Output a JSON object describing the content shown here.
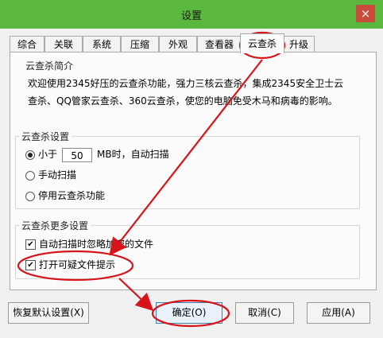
{
  "window": {
    "title": "设置",
    "close_label": "×"
  },
  "tabs": [
    {
      "label": "综合"
    },
    {
      "label": "关联"
    },
    {
      "label": "系统"
    },
    {
      "label": "压缩"
    },
    {
      "label": "外观"
    },
    {
      "label": "查看器"
    },
    {
      "label": "云查杀",
      "active": true
    },
    {
      "label": "升级"
    }
  ],
  "intro": {
    "title": "云查杀简介",
    "line1": "欢迎使用2345好压的云查杀功能，强力三核云查杀，集成2345安全卫士云",
    "line2": "查杀、QQ管家云查杀、360云查杀，使您的电脑免受木马和病毒的影响。"
  },
  "settings": {
    "title": "云查杀设置",
    "option_size_prefix": "小于",
    "size_value": "50",
    "option_size_suffix": "MB时，自动扫描",
    "option_manual": "手动扫描",
    "option_disable": "停用云查杀功能"
  },
  "more": {
    "title": "云查杀更多设置",
    "skip_encrypted": "自动扫描时忽略加密的文件",
    "show_suspicious": "打开可疑文件提示"
  },
  "buttons": {
    "restore": "恢复默认设置(X)",
    "ok": "确定(O)",
    "cancel": "取消(C)",
    "apply": "应用(A)"
  },
  "colors": {
    "titlebar": "#59b83d",
    "annotation": "#d8141b"
  },
  "checkmark": "✔"
}
